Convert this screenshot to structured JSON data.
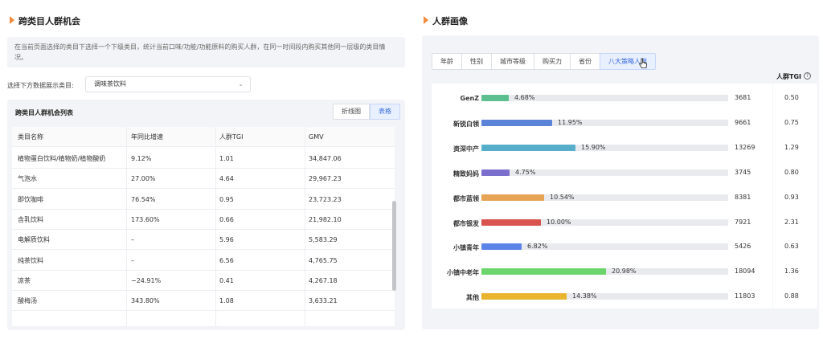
{
  "left": {
    "title": "跨类目人群机会",
    "description": "在当前页面选择的类目下选择一个下级类目，统计当前口味/功能/功能原料的购买人群，在同一时间段内购买其他同一层级的类目情况。",
    "select_label": "选择下方数据展示类目:",
    "select_value": "调味茶饮料",
    "list_title": "跨类目人群机会列表",
    "toggle": [
      "折线图",
      "表格"
    ],
    "columns": [
      "类目名称",
      "年同比增速",
      "人群TGI",
      "GMV"
    ],
    "rows": [
      [
        "植物蛋白饮料/植物奶/植物酸奶",
        "9.12%",
        "1.01",
        "34,847.06"
      ],
      [
        "气泡水",
        "27.00%",
        "4.64",
        "29,967.23"
      ],
      [
        "即饮咖啡",
        "76.54%",
        "0.95",
        "23,723.23"
      ],
      [
        "含乳饮料",
        "173.60%",
        "0.66",
        "21,982.10"
      ],
      [
        "电解质饮料",
        "–",
        "5.96",
        "5,583.29"
      ],
      [
        "纯茶饮料",
        "–",
        "6.56",
        "4,765.75"
      ],
      [
        "凉茶",
        "−24.91%",
        "0.41",
        "4,267.18"
      ],
      [
        "酸梅汤",
        "343.80%",
        "1.08",
        "3,633.21"
      ]
    ]
  },
  "right": {
    "title": "人群画像",
    "tabs": [
      "年龄",
      "性别",
      "城市等级",
      "购买力",
      "省份",
      "八大策略人群"
    ],
    "active_tab": 5,
    "tgi_header": "人群TGI",
    "help_glyph": "?",
    "groups": [
      {
        "name": "GenZ",
        "pct_label": "4.68%",
        "pct": 4.68,
        "value": "3681",
        "tgi": "0.50",
        "color": "#5bbf8f"
      },
      {
        "name": "新锐白领",
        "pct_label": "11.95%",
        "pct": 11.95,
        "value": "9661",
        "tgi": "0.75",
        "color": "#5b84d9"
      },
      {
        "name": "资深中产",
        "pct_label": "15.90%",
        "pct": 15.9,
        "value": "13269",
        "tgi": "1.29",
        "color": "#56aecb"
      },
      {
        "name": "精致妈妈",
        "pct_label": "4.75%",
        "pct": 4.75,
        "value": "3745",
        "tgi": "0.80",
        "color": "#7b6fce"
      },
      {
        "name": "都市蓝领",
        "pct_label": "10.54%",
        "pct": 10.54,
        "value": "8381",
        "tgi": "0.93",
        "color": "#e6a454"
      },
      {
        "name": "都市银发",
        "pct_label": "10.00%",
        "pct": 10.0,
        "value": "7921",
        "tgi": "2.31",
        "color": "#d9534f"
      },
      {
        "name": "小镇青年",
        "pct_label": "6.82%",
        "pct": 6.82,
        "value": "5426",
        "tgi": "0.63",
        "color": "#5b84e9"
      },
      {
        "name": "小镇中老年",
        "pct_label": "20.98%",
        "pct": 20.98,
        "value": "18094",
        "tgi": "1.36",
        "color": "#6bd46b"
      },
      {
        "name": "其他",
        "pct_label": "14.38%",
        "pct": 14.38,
        "value": "11803",
        "tgi": "0.88",
        "color": "#e9b42e"
      }
    ]
  }
}
